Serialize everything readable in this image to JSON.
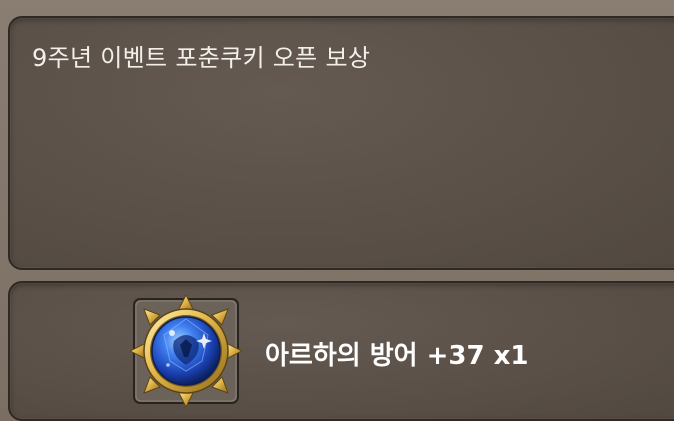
{
  "message": {
    "title": "9주년 이벤트 포춘쿠키 오픈 보상"
  },
  "reward": {
    "item_icon": "blue-gem-shield-icon",
    "item_label": "아르하의 방어 +37 x1"
  },
  "colors": {
    "panel_bg": "#5a5048",
    "panel_border": "#2f2823",
    "frame_bg": "#7c6f64",
    "text": "#f3f0ea",
    "gem_blue": "#1f4fc9",
    "gold": "#d9b24a"
  }
}
